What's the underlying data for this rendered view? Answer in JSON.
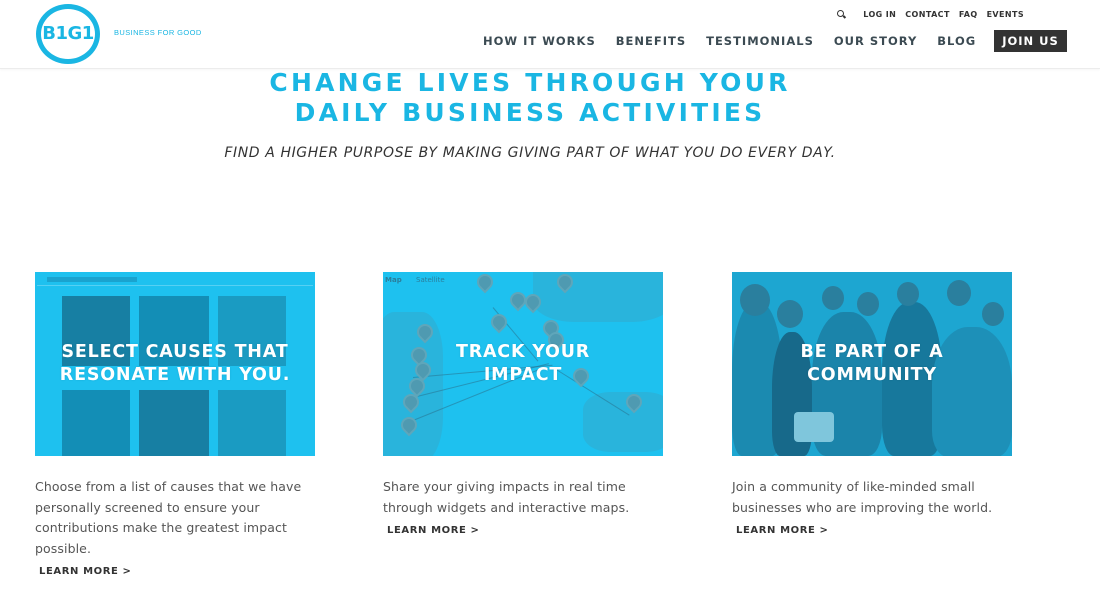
{
  "brand": {
    "logo_text": "B1G1",
    "tagline": "BUSINESS FOR GOOD",
    "accent_color": "#1ab6e3"
  },
  "utility_nav": {
    "search_icon": "search-icon",
    "items": [
      "LOG IN",
      "CONTACT",
      "FAQ",
      "EVENTS"
    ]
  },
  "main_nav": {
    "items": [
      "HOW IT WORKS",
      "BENEFITS",
      "TESTIMONIALS",
      "OUR STORY",
      "BLOG"
    ],
    "cta": "JOIN US"
  },
  "hero": {
    "title_line1": "CHANGE LIVES THROUGH YOUR",
    "title_line2": "DAILY BUSINESS ACTIVITIES",
    "subtitle": "FIND A HIGHER PURPOSE BY MAKING GIVING PART OF WHAT YOU DO EVERY DAY."
  },
  "cards": [
    {
      "title_line1": "SELECT CAUSES THAT",
      "title_line2": "RESONATE WITH YOU.",
      "description": "Choose from a list of causes that we have personally screened to ensure your contributions make the greatest impact possible.",
      "link": "LEARN MORE >"
    },
    {
      "title_line1": "TRACK YOUR",
      "title_line2": "IMPACT",
      "map_tabs": [
        "Map",
        "Satellite"
      ],
      "description": "Share your giving impacts in real time through widgets and interactive maps.",
      "link": "LEARN MORE >"
    },
    {
      "title_line1": "BE PART OF A",
      "title_line2": "COMMUNITY",
      "description": "Join a community of like-minded small businesses who are improving the world.",
      "link": "LEARN MORE >"
    }
  ]
}
